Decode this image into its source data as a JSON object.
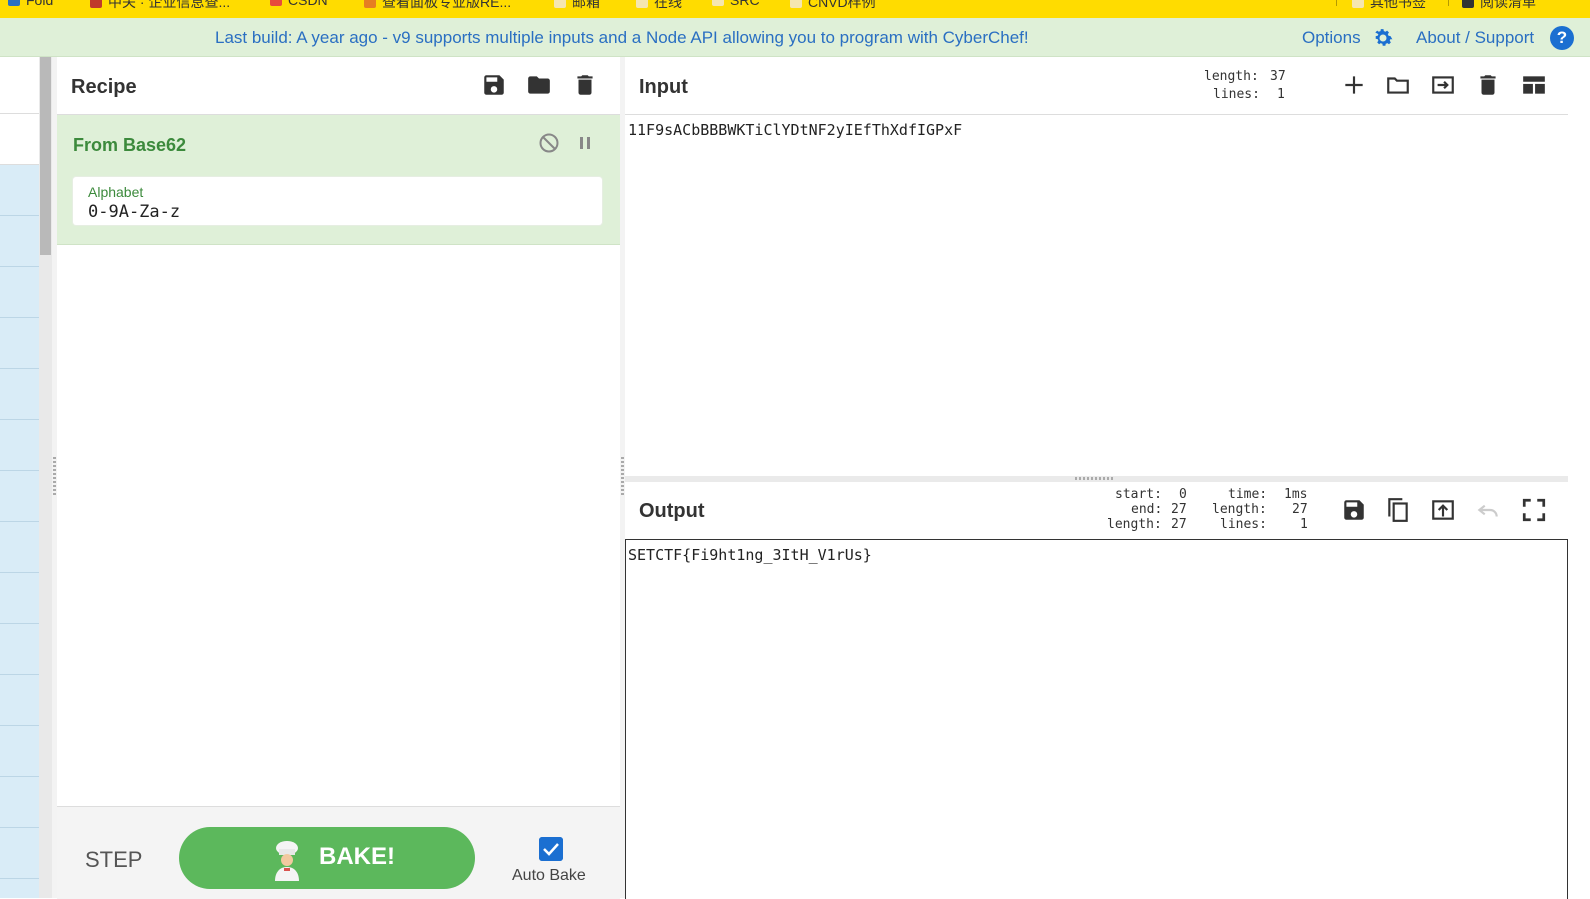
{
  "bookmarks": {
    "items": [
      "Fold",
      "中关 · 企业信息查...",
      "CSDN",
      "查看面板专业版RE...",
      "邮箱",
      "在线",
      "SRC",
      "CNVD样例"
    ],
    "right_items": [
      "其他书签",
      "阅读清单"
    ]
  },
  "banner": {
    "message_prefix": "Last build: A year ago - v9 supports multiple inputs and a ",
    "node_api_link": "Node API",
    "message_suffix": " allowing you to program with CyberChef!",
    "options": "Options",
    "about": "About / Support",
    "help_glyph": "?"
  },
  "recipe": {
    "title": "Recipe",
    "operation": {
      "name": "From Base62",
      "arg_label": "Alphabet",
      "arg_value": "0-9A-Za-z"
    },
    "controls": {
      "step": "STEP",
      "bake": "BAKE!",
      "auto_bake": "Auto Bake",
      "auto_bake_checked": true
    }
  },
  "input": {
    "title": "Input",
    "length_label": "length:",
    "length": "37",
    "lines_label": "lines:",
    "lines": "1",
    "text": "11F9sACbBBBWKTiClYDtNF2yIEfThXdfIGPxF"
  },
  "output": {
    "title": "Output",
    "start_label": "start:",
    "start": "0",
    "end_label": "end:",
    "end": "27",
    "sel_length_label": "length:",
    "sel_length": "27",
    "time_label": "time:",
    "time": "1ms",
    "length_label": "length:",
    "length": "27",
    "lines_label": "lines:",
    "lines": "1",
    "text": "SETCTF{Fi9ht1ng_3ItH_V1rUs}"
  },
  "colors": {
    "banner_bg": "#dff0d8",
    "link": "#2a6fc2",
    "operation_green": "#3c8a3c",
    "bake_green": "#5cb85c",
    "bookmark_bar": "#ffdc00"
  }
}
